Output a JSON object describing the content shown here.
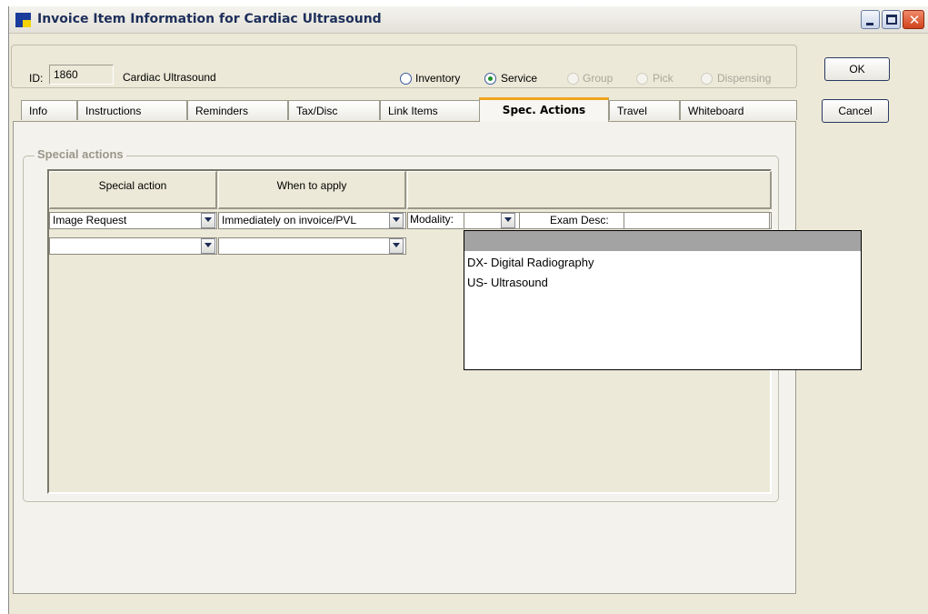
{
  "window": {
    "title": "Invoice Item Information for Cardiac Ultrasound",
    "controls": [
      "minimize-icon",
      "maximize-icon",
      "close-icon"
    ]
  },
  "item": {
    "id_label": "ID:",
    "id_value": "1860",
    "name": "Cardiac Ultrasound",
    "types": [
      {
        "label": "Inventory",
        "selected": false,
        "enabled": true
      },
      {
        "label": "Service",
        "selected": true,
        "enabled": true
      },
      {
        "label": "Group",
        "selected": false,
        "enabled": false
      },
      {
        "label": "Pick",
        "selected": false,
        "enabled": false
      },
      {
        "label": "Dispensing",
        "selected": false,
        "enabled": false
      }
    ]
  },
  "buttons": {
    "ok": "OK",
    "cancel": "Cancel"
  },
  "tabs": [
    {
      "label": "Info"
    },
    {
      "label": "Instructions"
    },
    {
      "label": "Reminders"
    },
    {
      "label": "Tax/Disc"
    },
    {
      "label": "Link Items"
    },
    {
      "label": "Spec. Actions",
      "active": true
    },
    {
      "label": "Travel"
    },
    {
      "label": "Whiteboard"
    }
  ],
  "special_actions": {
    "group_title": "Special actions",
    "columns": [
      "Special action",
      "When to apply",
      ""
    ],
    "rows": [
      {
        "action": "Image Request",
        "when": "Immediately on invoice/PVL",
        "modality_label": "Modality:",
        "modality_value": "",
        "exam_desc_label": "Exam Desc:",
        "exam_desc_value": ""
      },
      {
        "action": "",
        "when": ""
      }
    ]
  },
  "modality_dropdown": {
    "options": [
      "",
      "DX- Digital Radiography",
      "US- Ultrasound"
    ]
  },
  "colors": {
    "active_tab_accent": "#f0a51d",
    "window_bg": "#ece9d8",
    "selected_radio": "#1f8f2c"
  }
}
